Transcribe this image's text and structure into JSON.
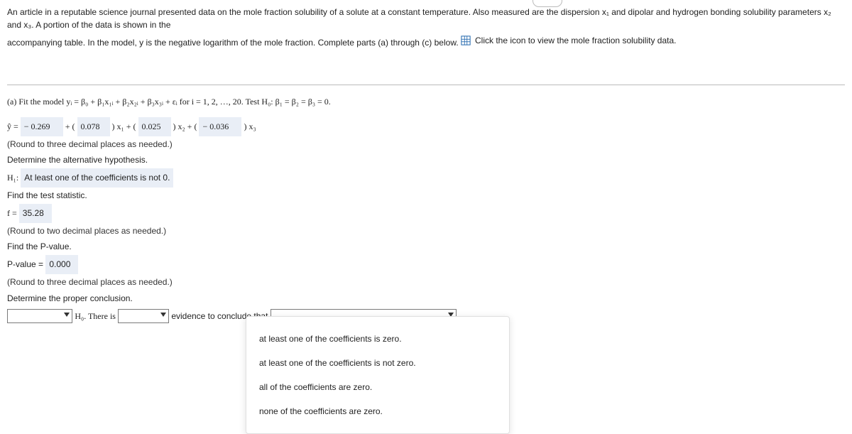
{
  "intro": {
    "line1": "An article in a reputable science journal presented data on the mole fraction solubility of a solute at a constant temperature. Also measured are the dispersion x₁ and dipolar and hydrogen bonding solubility parameters x₂ and x₃. A portion of the data is shown in the",
    "line2": "accompanying table. In the model, y is the negative logarithm of the mole fraction. Complete parts (a) through (c) below.",
    "iconLink": "Click the icon to view the mole fraction solubility data."
  },
  "pill": "· · ·",
  "partA": {
    "prompt": "(a) Fit the model yᵢ = β₀ + β₁x₁ᵢ + β₂x₂ᵢ + β₃x₃ᵢ + εᵢ for i = 1, 2, …, 20. Test H₀: β₁ = β₂ = β₃ = 0.",
    "eq_prefix": "ŷ = ",
    "b0": "− 0.269",
    "plus1": " + ( ",
    "b1": "0.078",
    "mid1": " ) x₁ + ( ",
    "b2": "0.025",
    "mid2": " ) x₂ + ( ",
    "b3": "− 0.036",
    "mid3": " ) x₃",
    "round3": "(Round to three decimal places as needed.)",
    "altHypPrompt": "Determine the alternative hypothesis.",
    "h1_label": "H₁: ",
    "h1_value": "At least one of the coefficients is not 0.",
    "findTS": "Find the test statistic.",
    "f_label": "f = ",
    "f_value": "35.28",
    "round2": "(Round to two decimal places as needed.)",
    "findP": "Find the P-value.",
    "p_label": "P-value = ",
    "p_value": "0.000",
    "round3b": "(Round to three decimal places as needed.)",
    "concludePrompt": "Determine the proper conclusion.",
    "conc_mid1": " H₀. There is ",
    "conc_mid2": " evidence to conclude that "
  },
  "popupOptions": [
    "at least one of the coefficients is zero.",
    "at least one of the coefficients is not zero.",
    "all of the coefficients are zero.",
    "none of the coefficients are zero."
  ]
}
